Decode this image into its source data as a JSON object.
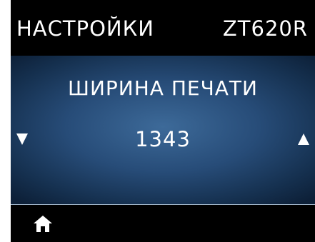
{
  "header": {
    "title": "НАСТРОЙКИ",
    "model": "ZT620R"
  },
  "setting": {
    "name": "ШИРИНА ПЕЧАТИ",
    "value": "1343"
  },
  "controls": {
    "decrease_icon": "down-triangle-icon",
    "increase_icon": "up-triangle-icon",
    "home_icon": "home-icon"
  },
  "colors": {
    "panel_center": "#3d6a99",
    "panel_edge": "#0d2038",
    "background": "#000000",
    "text": "#ffffff"
  }
}
